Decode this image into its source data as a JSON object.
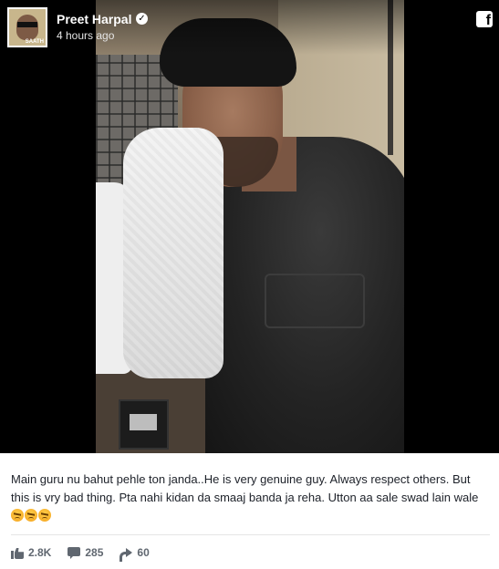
{
  "post": {
    "author_name": "Preet Harpal",
    "verified_icon": "verified-check-icon",
    "timestamp": "4 hours ago",
    "avatar_text": "SAATH",
    "platform_icon": "facebook-icon",
    "platform_glyph": "f",
    "caption_text": "Main guru nu bahut pehle ton janda..He is very genuine guy. Always respect others. But this is vry bad thing. Pta nahi kidan da smaaj banda ja reha. Utton aa sale swad lain wale",
    "caption_emojis": [
      "angry-face-icon",
      "angry-face-icon",
      "angry-face-icon"
    ]
  },
  "stats": {
    "likes": "2.8K",
    "comments": "285",
    "shares": "60",
    "like_icon": "thumbs-up-icon",
    "comment_icon": "comment-icon",
    "share_icon": "share-arrow-icon"
  },
  "colors": {
    "text": "#1d2129",
    "muted": "#606770",
    "video_background": "#000000"
  }
}
